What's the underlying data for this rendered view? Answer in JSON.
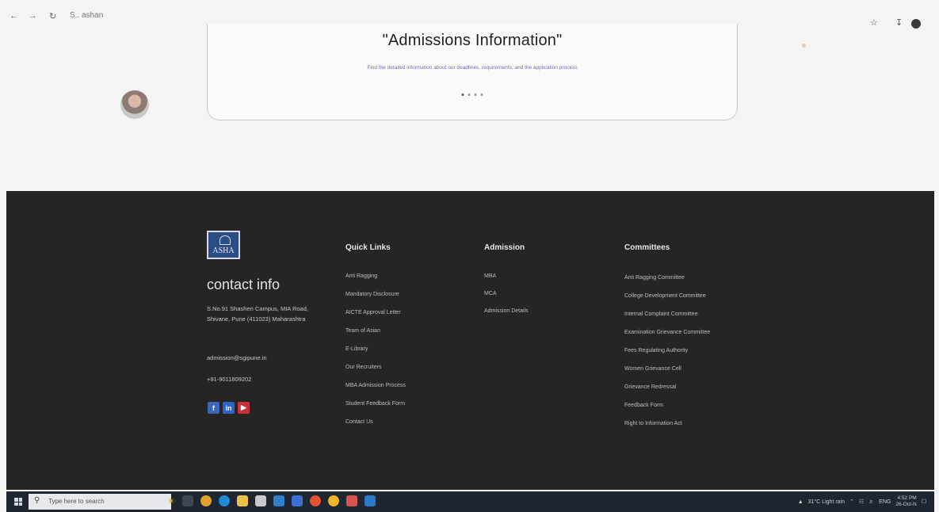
{
  "browser": {
    "back_icon": "back-arrow-icon",
    "forward_icon": "forward-arrow-icon",
    "refresh_icon": "refresh-icon",
    "url_text": "S.. ashan"
  },
  "card": {
    "title": "\"Admissions Information\"",
    "description": "Find the detailed information about our deadlines, requirements, and the application process"
  },
  "footer": {
    "logo_text": "ASHA",
    "contact": {
      "heading": "contact info",
      "address": "S.No.91 Shasheri Campus, MIA Road, Shivane, Pune (411023) Maharashtra",
      "email": "admission@sgipune.in",
      "phone": "+91-9011809202"
    },
    "quick_links": {
      "heading": "Quick Links",
      "items": [
        "Anti Ragging",
        "Mandatory Disclosure",
        "AICTE Approval Letter",
        "Team of Asian",
        "E-Library",
        "Our Recruiters",
        "MBA Admission Process",
        "Student Feedback Form",
        "Contact Us"
      ]
    },
    "admission": {
      "heading": "Admission",
      "items": [
        "MBA",
        "MCA",
        "Admission Details"
      ]
    },
    "committees": {
      "heading": "Committees",
      "items": [
        "Anti Ragging Committee",
        "College Development Committee",
        "Internal Complaint Committee",
        "Examination Grievance Committee",
        "Fees Regulating Authority",
        "Women Grievance Cell",
        "Grievance Redressal",
        "Feedback Form",
        "Right to Information Act"
      ]
    }
  },
  "taskbar": {
    "search_placeholder": "Type here to search",
    "weather": "31°C Light rain",
    "language": "ENG",
    "time": "4:52 PM",
    "date": "26-Oct-N"
  },
  "colors": {
    "footer_bg": "#262524",
    "facebook": "#3b67b5",
    "linkedin": "#2d63c4",
    "youtube": "#c9323a"
  }
}
